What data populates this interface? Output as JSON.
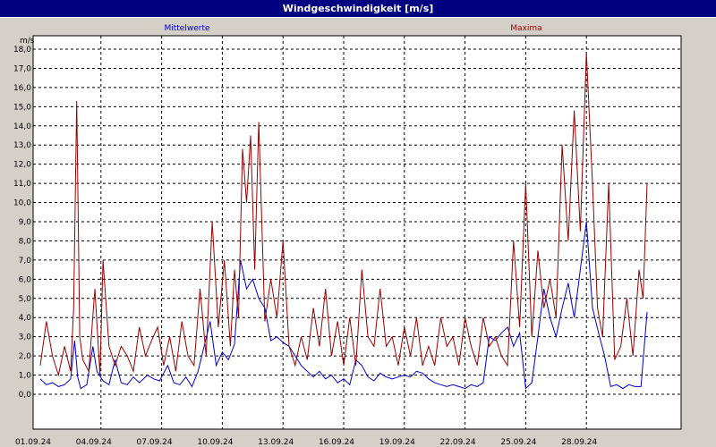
{
  "window": {
    "title": "Windgeschwindigkeit [m/s]"
  },
  "chart_data": {
    "type": "line",
    "ylabel": "m/s",
    "ylim": [
      0,
      18
    ],
    "xlim": [
      0,
      30
    ],
    "grid": true,
    "legend": [
      "Mittelwerte",
      "Maxima"
    ],
    "x_tick_labels": [
      "01.09.24",
      "04.09.24",
      "07.09.24",
      "10.09.24",
      "13.09.24",
      "16.09.24",
      "19.09.24",
      "22.09.24",
      "25.09.24",
      "28.09.24"
    ],
    "x_tick_days": [
      0,
      3,
      6,
      9,
      12,
      15,
      18,
      21,
      24,
      27
    ],
    "y_tick_labels": [
      "0,0",
      "1,0",
      "2,0",
      "3,0",
      "4,0",
      "5,0",
      "6,0",
      "7,0",
      "8,0",
      "9,0",
      "10,0",
      "11,0",
      "12,0",
      "13,0",
      "14,0",
      "15,0",
      "16,0",
      "17,0",
      "18,0"
    ],
    "colors": {
      "Mittelwerte": "#0000cc",
      "Maxima": "#990000",
      "background": "#ffffff",
      "grid": "#000000"
    },
    "series": [
      {
        "name": "Mittelwerte",
        "x": [
          0,
          0.3,
          0.6,
          0.9,
          1.2,
          1.5,
          1.7,
          1.85,
          2.0,
          2.3,
          2.6,
          2.8,
          3.1,
          3.4,
          3.7,
          4.0,
          4.3,
          4.6,
          4.9,
          5.3,
          5.6,
          5.9,
          6.3,
          6.6,
          6.9,
          7.2,
          7.5,
          7.8,
          8.1,
          8.4,
          8.7,
          9.0,
          9.3,
          9.6,
          9.9,
          10.2,
          10.5,
          10.8,
          11.1,
          11.4,
          11.7,
          12.0,
          12.3,
          12.6,
          12.9,
          13.2,
          13.5,
          13.8,
          14.1,
          14.4,
          14.7,
          15.0,
          15.3,
          15.6,
          15.9,
          16.2,
          16.5,
          16.8,
          17.1,
          17.4,
          17.7,
          18.0,
          18.3,
          18.6,
          18.9,
          19.2,
          19.5,
          19.8,
          20.1,
          20.4,
          20.7,
          21.0,
          21.3,
          21.6,
          21.9,
          22.2,
          22.5,
          22.8,
          23.1,
          23.4,
          23.7,
          24.0,
          24.3,
          24.6,
          24.9,
          25.2,
          25.5,
          25.8,
          26.1,
          26.4,
          26.7,
          27.0,
          27.3,
          27.6,
          27.9,
          28.2,
          28.5,
          28.8,
          29.1,
          29.4,
          29.7,
          30.0
        ],
        "y": [
          0.8,
          0.5,
          0.6,
          0.4,
          0.5,
          0.8,
          2.8,
          0.9,
          0.3,
          0.5,
          2.5,
          1.2,
          0.7,
          0.5,
          1.8,
          0.6,
          0.5,
          0.9,
          0.6,
          1.0,
          0.8,
          0.7,
          1.5,
          0.6,
          0.5,
          0.9,
          0.4,
          1.2,
          2.5,
          3.8,
          1.5,
          2.2,
          1.8,
          2.6,
          7.0,
          5.5,
          6.0,
          5.0,
          4.5,
          2.8,
          3.0,
          2.7,
          2.5,
          2.0,
          1.5,
          1.2,
          0.9,
          1.2,
          0.8,
          1.0,
          0.6,
          0.8,
          0.5,
          1.8,
          1.5,
          0.9,
          0.7,
          1.1,
          0.9,
          0.8,
          0.9,
          1.0,
          0.9,
          1.2,
          1.1,
          0.8,
          0.6,
          0.5,
          0.4,
          0.5,
          0.4,
          0.3,
          0.5,
          0.4,
          0.6,
          3.0,
          2.8,
          3.2,
          3.5,
          2.5,
          3.2,
          0.3,
          0.6,
          3.0,
          5.5,
          4.0,
          3.0,
          4.5,
          5.8,
          4.0,
          6.5,
          9.0,
          4.5,
          3.2,
          2.0,
          0.4,
          0.5,
          0.3,
          0.5,
          0.4,
          0.4,
          4.3
        ]
      },
      {
        "name": "Maxima",
        "x": [
          0,
          0.3,
          0.6,
          0.9,
          1.2,
          1.5,
          1.65,
          1.8,
          1.95,
          2.1,
          2.4,
          2.7,
          2.95,
          3.1,
          3.4,
          3.7,
          4.0,
          4.3,
          4.6,
          4.9,
          5.2,
          5.5,
          5.8,
          6.1,
          6.4,
          6.7,
          7.0,
          7.3,
          7.6,
          7.9,
          8.2,
          8.5,
          8.8,
          9.1,
          9.4,
          9.6,
          9.8,
          10.0,
          10.2,
          10.4,
          10.6,
          10.8,
          11.1,
          11.4,
          11.7,
          12.0,
          12.3,
          12.6,
          12.9,
          13.2,
          13.5,
          13.8,
          14.1,
          14.4,
          14.7,
          15.0,
          15.3,
          15.6,
          15.9,
          16.2,
          16.5,
          16.8,
          17.1,
          17.4,
          17.7,
          18.0,
          18.3,
          18.6,
          18.9,
          19.2,
          19.5,
          19.8,
          20.1,
          20.4,
          20.7,
          21.0,
          21.3,
          21.6,
          21.9,
          22.2,
          22.5,
          22.8,
          23.1,
          23.4,
          23.7,
          24.0,
          24.3,
          24.6,
          24.9,
          25.2,
          25.5,
          25.8,
          26.1,
          26.4,
          26.7,
          27.0,
          27.3,
          27.55,
          27.8,
          28.1,
          28.4,
          28.7,
          29.0,
          29.3,
          29.6,
          29.8,
          30.0
        ],
        "y": [
          1.5,
          3.8,
          2.0,
          1.0,
          2.5,
          1.2,
          4.5,
          15.3,
          3.0,
          1.8,
          1.2,
          5.5,
          1.0,
          7.0,
          2.5,
          1.5,
          2.5,
          2.0,
          1.2,
          3.5,
          2.0,
          2.8,
          3.5,
          1.5,
          3.0,
          1.2,
          3.8,
          2.0,
          1.5,
          5.5,
          2.0,
          9.0,
          3.5,
          7.0,
          2.5,
          6.5,
          4.0,
          12.8,
          10.0,
          13.5,
          6.5,
          14.2,
          3.8,
          6.0,
          4.0,
          8.0,
          2.5,
          1.5,
          3.0,
          1.8,
          4.5,
          2.5,
          5.5,
          2.0,
          3.8,
          1.5,
          4.0,
          1.5,
          6.5,
          3.0,
          2.5,
          5.5,
          2.5,
          3.0,
          1.5,
          3.5,
          2.0,
          4.0,
          1.5,
          2.5,
          1.5,
          4.0,
          2.5,
          3.0,
          1.5,
          4.0,
          2.5,
          1.5,
          4.0,
          2.5,
          3.0,
          2.0,
          1.5,
          8.0,
          3.5,
          11.0,
          3.0,
          7.5,
          4.5,
          6.0,
          4.0,
          13.0,
          8.0,
          14.8,
          8.5,
          17.8,
          11.0,
          4.5,
          3.0,
          11.0,
          1.8,
          2.5,
          5.0,
          2.0,
          6.5,
          5.0,
          11.0
        ]
      }
    ]
  }
}
